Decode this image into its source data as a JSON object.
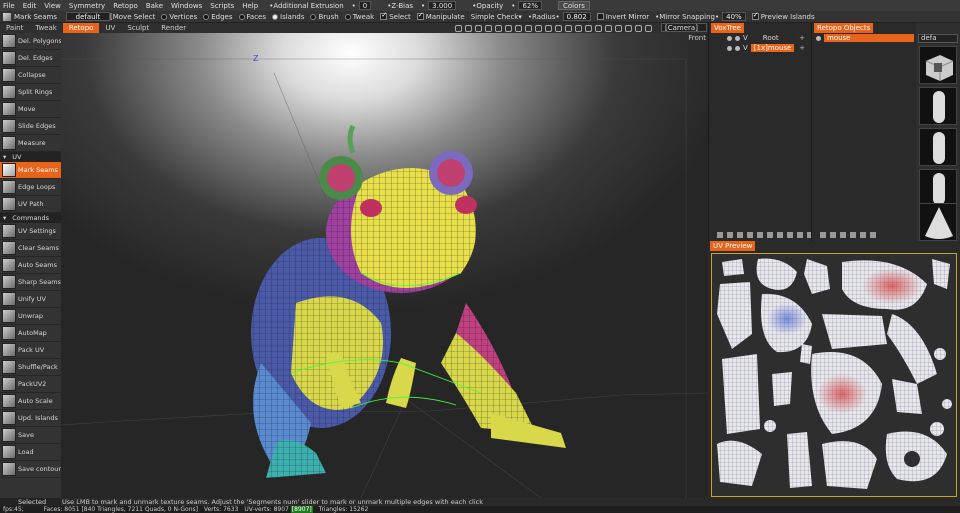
{
  "menu": [
    "File",
    "Edit",
    "View",
    "Symmetry",
    "Retopo",
    "Bake",
    "Windows",
    "Scripts",
    "Help"
  ],
  "toolbar": {
    "tool_name": "Mark Seams",
    "preset": "default",
    "move_select": "[Move Select",
    "vertices": "Vertices",
    "edges": "Edges",
    "faces": "Faces",
    "islands": "Islands",
    "brush": "Brush",
    "tweak": "Tweak",
    "select": "Select",
    "manipulate": "Manipulate",
    "simple_check": "Simple Check",
    "radius_label": "Radius",
    "radius_value": "0.802",
    "invert_mirror": "Invert Mirror",
    "mirror_snapping_label": "Mirror Snapping",
    "mirror_snapping_value": "40%",
    "preview_islands": "Preview Islands",
    "additional_extrusion_label": "Additional Extrusion",
    "additional_extrusion_value": "0",
    "zbias_label": "Z-Bias",
    "zbias_value": "3.000",
    "opacity_label": "Opacity",
    "opacity_value": "62%",
    "colors": "Colors"
  },
  "tabs": {
    "paint": "Paint",
    "tweak": "Tweak",
    "retopo": "Retopo",
    "uv": "UV",
    "sculpt": "Sculpt",
    "render": "Render",
    "camera": "[Camera]",
    "front": "Front"
  },
  "tools": [
    {
      "type": "tool",
      "label": "Del. Polygons"
    },
    {
      "type": "tool",
      "label": "Del. Edges"
    },
    {
      "type": "tool",
      "label": "Collapse"
    },
    {
      "type": "tool",
      "label": "Split Rings"
    },
    {
      "type": "tool",
      "label": "Move"
    },
    {
      "type": "tool",
      "label": "Slide Edges"
    },
    {
      "type": "tool",
      "label": "Measure"
    },
    {
      "type": "section",
      "label": "UV"
    },
    {
      "type": "tool",
      "label": "Mark Seams",
      "active": true
    },
    {
      "type": "tool",
      "label": "Edge Loops"
    },
    {
      "type": "tool",
      "label": "UV Path"
    },
    {
      "type": "section",
      "label": "Commands"
    },
    {
      "type": "tool",
      "label": "UV Settings"
    },
    {
      "type": "tool",
      "label": "Clear Seams"
    },
    {
      "type": "tool",
      "label": "Auto Seams"
    },
    {
      "type": "tool",
      "label": "Sharp Seams"
    },
    {
      "type": "tool",
      "label": "Unify UV"
    },
    {
      "type": "tool",
      "label": "Unwrap"
    },
    {
      "type": "tool",
      "label": "AutoMap"
    },
    {
      "type": "tool",
      "label": "Pack UV"
    },
    {
      "type": "tool",
      "label": "Shuffle/Pack"
    },
    {
      "type": "tool",
      "label": "PackUV2"
    },
    {
      "type": "tool",
      "label": "Auto Scale"
    },
    {
      "type": "tool",
      "label": "Upd. Islands"
    },
    {
      "type": "tool",
      "label": "Save"
    },
    {
      "type": "tool",
      "label": "Load"
    },
    {
      "type": "tool",
      "label": "Save contour"
    }
  ],
  "viewport": {
    "z_axis": "Z"
  },
  "voxtree": {
    "title": "VoxTree",
    "root": "Root",
    "root_v": "V",
    "object": "[1x]mouse",
    "object_v": "V"
  },
  "retopo_objects": {
    "title": "Retopo Objects",
    "object": "mouse"
  },
  "presets": {
    "dropdown": "defa"
  },
  "uv_preview": {
    "title": "UV Preview"
  },
  "hint": {
    "selected": "Selected",
    "text": "Use LMB to mark and unmark texture seams. Adjust the 'Segments num' slider to mark or unmark multiple edges with each click"
  },
  "status": {
    "fps": "fps:45;",
    "faces": "Faces: 8051 [840 Triangles, 7211 Quads, 0 N-Gons]",
    "verts": "Verts: 7633",
    "uv_verts_label": "UV-verts: 8907",
    "uv_verts_highlight": "[8907]",
    "triangles": "Triangles: 15262"
  },
  "colors": {
    "accent": "#e8641a",
    "uv_frame": "#c9a227"
  }
}
